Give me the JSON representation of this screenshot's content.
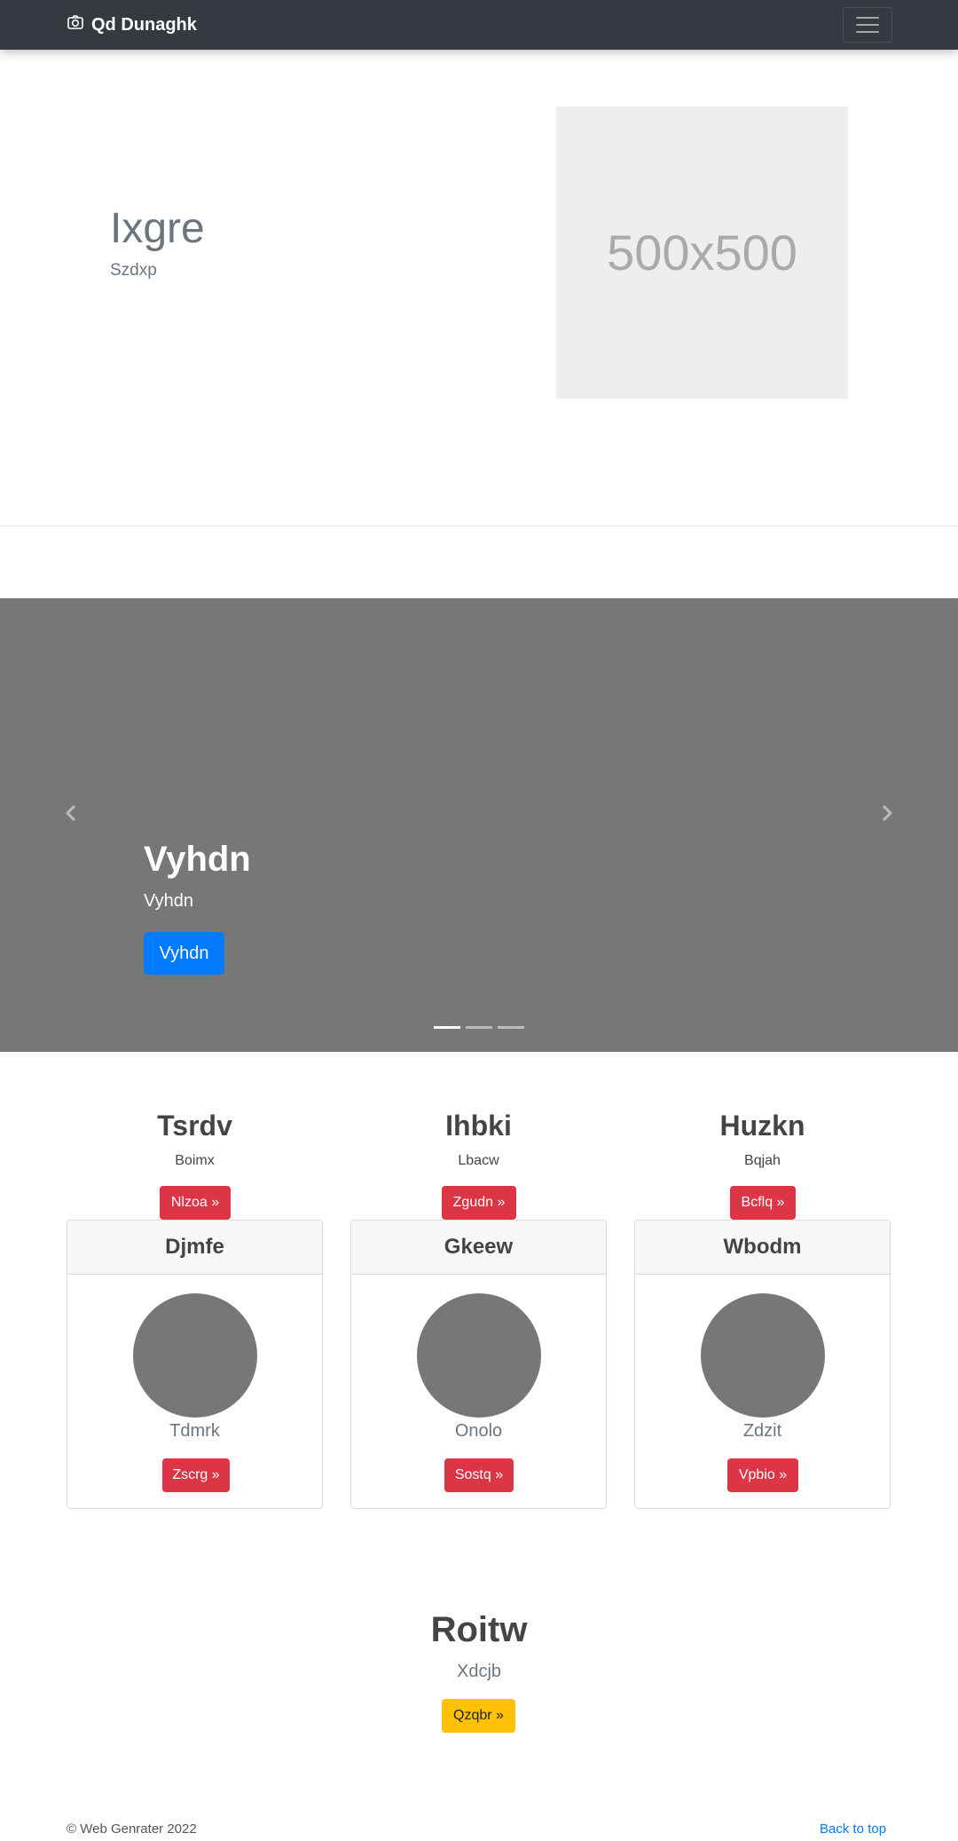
{
  "navbar": {
    "brand": "Qd Dunaghk",
    "brand_icon": "camera-icon",
    "toggler_icon": "hamburger-menu-icon"
  },
  "hero": {
    "title": "Ixgre",
    "subtitle": "Szdxp",
    "image_placeholder": "500x500"
  },
  "carousel": {
    "title": "Vyhdn",
    "subtitle": "Vyhdn",
    "button": "Vyhdn",
    "slide_count": 3,
    "active_slide": 1,
    "prev_icon": "chevron-left-icon",
    "next_icon": "chevron-right-icon"
  },
  "columns": [
    {
      "title": "Tsrdv",
      "text": "Boimx",
      "button": "Nlzoa »"
    },
    {
      "title": "Ihbki",
      "text": "Lbacw",
      "button": "Zgudn »"
    },
    {
      "title": "Huzkn",
      "text": "Bqjah",
      "button": "Bcflq »"
    }
  ],
  "cards": [
    {
      "header": "Djmfe",
      "text": "Tdmrk",
      "button": "Zscrg »"
    },
    {
      "header": "Gkeew",
      "text": "Onolo",
      "button": "Sostq »"
    },
    {
      "header": "Wbodm",
      "text": "Zdzit",
      "button": "Vpbio »"
    }
  ],
  "bottom": {
    "title": "Roitw",
    "subtitle": "Xdcjb",
    "button": "Qzqbr »"
  },
  "footer": {
    "copyright": "© Web Genrater 2022",
    "back_to_top": "Back to top"
  },
  "colors": {
    "navbar": "#343a40",
    "primary": "#007bff",
    "danger": "#dc3545",
    "warning": "#ffc107",
    "placeholder_gray": "#777777"
  }
}
